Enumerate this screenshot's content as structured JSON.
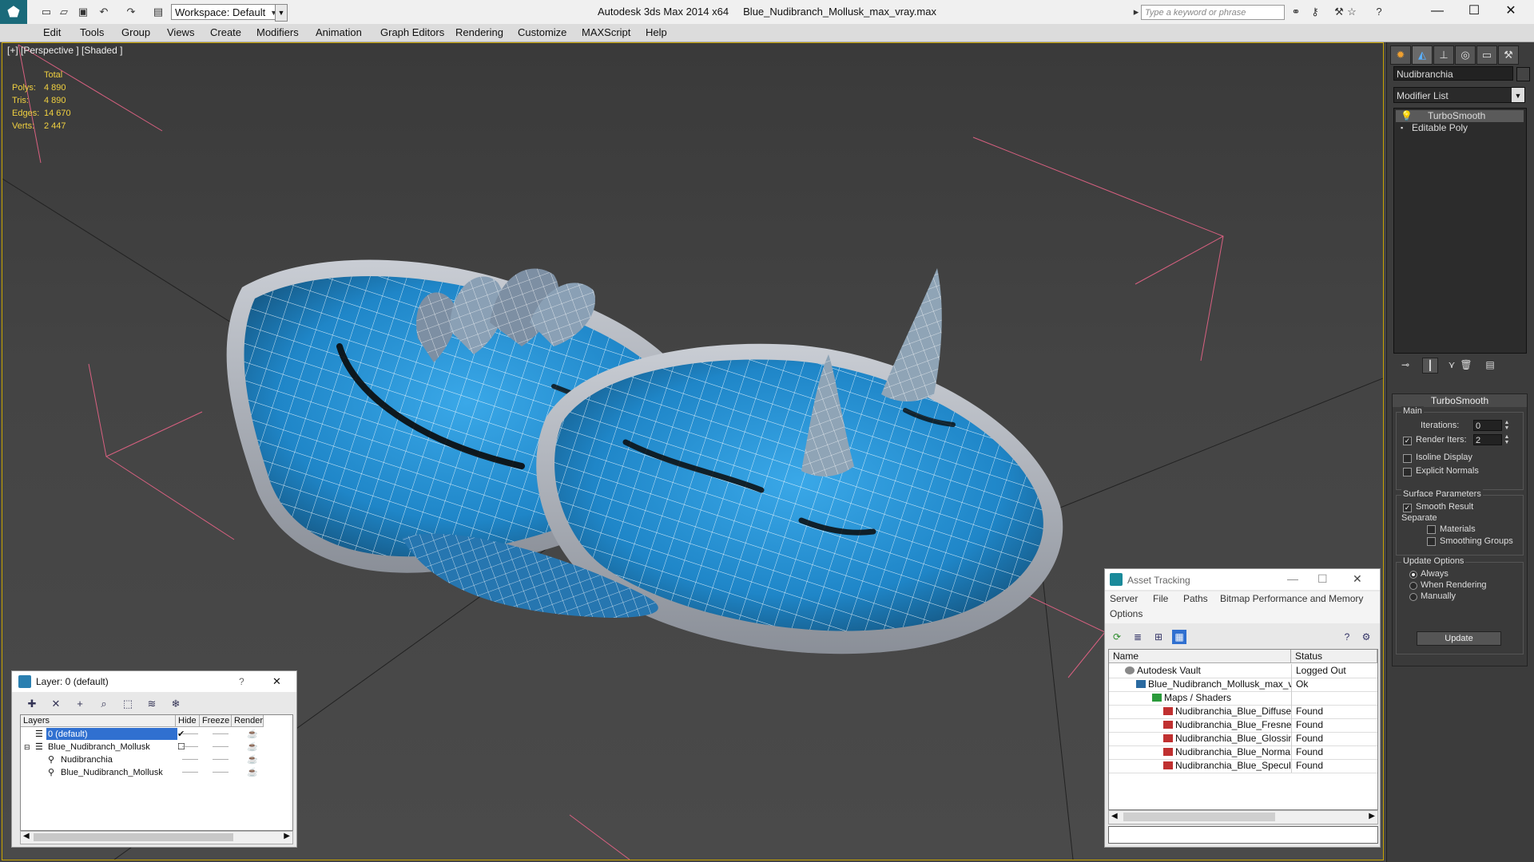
{
  "titlebar": {
    "app": "Autodesk 3ds Max  2014 x64",
    "file": "Blue_Nudibranch_Mollusk_max_vray.max",
    "workspace": "Workspace: Default",
    "search_placeholder": "Type a keyword or phrase",
    "icons": [
      "app-logo-icon",
      "new-icon",
      "open-icon",
      "save-icon",
      "undo-icon",
      "redo-icon",
      "binoculars-icon",
      "key-icon",
      "star-icon",
      "help-icon"
    ]
  },
  "menu": [
    "Edit",
    "Tools",
    "Group",
    "Views",
    "Create",
    "Modifiers",
    "Animation",
    "Graph Editors",
    "Rendering",
    "Customize",
    "MAXScript",
    "Help"
  ],
  "viewport": {
    "label": "[+] [Perspective ] [Shaded ]",
    "stats": {
      "header": "Total",
      "rows": [
        {
          "label": "Polys:",
          "value": "4 890"
        },
        {
          "label": "Tris:",
          "value": "4 890"
        },
        {
          "label": "Edges:",
          "value": "14 670"
        },
        {
          "label": "Verts:",
          "value": "2 447"
        }
      ]
    }
  },
  "command_panel": {
    "object_name": "Nudibranchia",
    "modifier_list": "Modifier List",
    "stack": [
      "TurboSmooth",
      "Editable Poly"
    ],
    "turbosmooth": {
      "title": "TurboSmooth",
      "main_label": "Main",
      "iterations_label": "Iterations:",
      "iterations_value": "0",
      "render_iters_label": "Render Iters:",
      "render_iters_value": "2",
      "isoline_label": "Isoline Display",
      "explicit_normals_label": "Explicit Normals",
      "surface_label": "Surface Parameters",
      "smooth_result_label": "Smooth Result",
      "separate_label": "Separate",
      "materials_label": "Materials",
      "smoothing_groups_label": "Smoothing Groups",
      "update_options_label": "Update Options",
      "always_label": "Always",
      "when_rendering_label": "When Rendering",
      "manually_label": "Manually",
      "update_button": "Update"
    }
  },
  "layer_dialog": {
    "title": "Layer: 0 (default)",
    "help": "?",
    "close": "✕",
    "columns": [
      "Layers",
      "Hide",
      "Freeze",
      "Render"
    ],
    "rows": [
      {
        "name": "0 (default)",
        "indent": 0,
        "selected": true
      },
      {
        "name": "Blue_Nudibranch_Mollusk",
        "indent": 0,
        "selected": false
      },
      {
        "name": "Nudibranchia",
        "indent": 1,
        "selected": false
      },
      {
        "name": "Blue_Nudibranch_Mollusk",
        "indent": 1,
        "selected": false
      }
    ]
  },
  "asset_dialog": {
    "title": "Asset Tracking",
    "menu": [
      "Server",
      "File",
      "Paths",
      "Bitmap Performance and Memory",
      "Options"
    ],
    "columns": [
      "Name",
      "Status"
    ],
    "rows": [
      {
        "name": "Autodesk Vault",
        "status": "Logged Out",
        "indent": 1,
        "icon": "vault"
      },
      {
        "name": "Blue_Nudibranch_Mollusk_max_vray.max",
        "status": "Ok",
        "indent": 2,
        "icon": "max"
      },
      {
        "name": "Maps / Shaders",
        "status": "",
        "indent": 3,
        "icon": "folder"
      },
      {
        "name": "Nudibranchia_Blue_Diffuse.png",
        "status": "Found",
        "indent": 4,
        "icon": "png"
      },
      {
        "name": "Nudibranchia_Blue_Fresnel.png",
        "status": "Found",
        "indent": 4,
        "icon": "png"
      },
      {
        "name": "Nudibranchia_Blue_Glossiness.png",
        "status": "Found",
        "indent": 4,
        "icon": "png"
      },
      {
        "name": "Nudibranchia_Blue_Normal.png",
        "status": "Found",
        "indent": 4,
        "icon": "png"
      },
      {
        "name": "Nudibranchia_Blue_Specular.png",
        "status": "Found",
        "indent": 4,
        "icon": "png"
      }
    ]
  },
  "colors": {
    "viewport_border": "#c8a400",
    "stats_text": "#f0d040",
    "selection": "#3070d0",
    "mesh_blue": "#2a8fd0"
  }
}
